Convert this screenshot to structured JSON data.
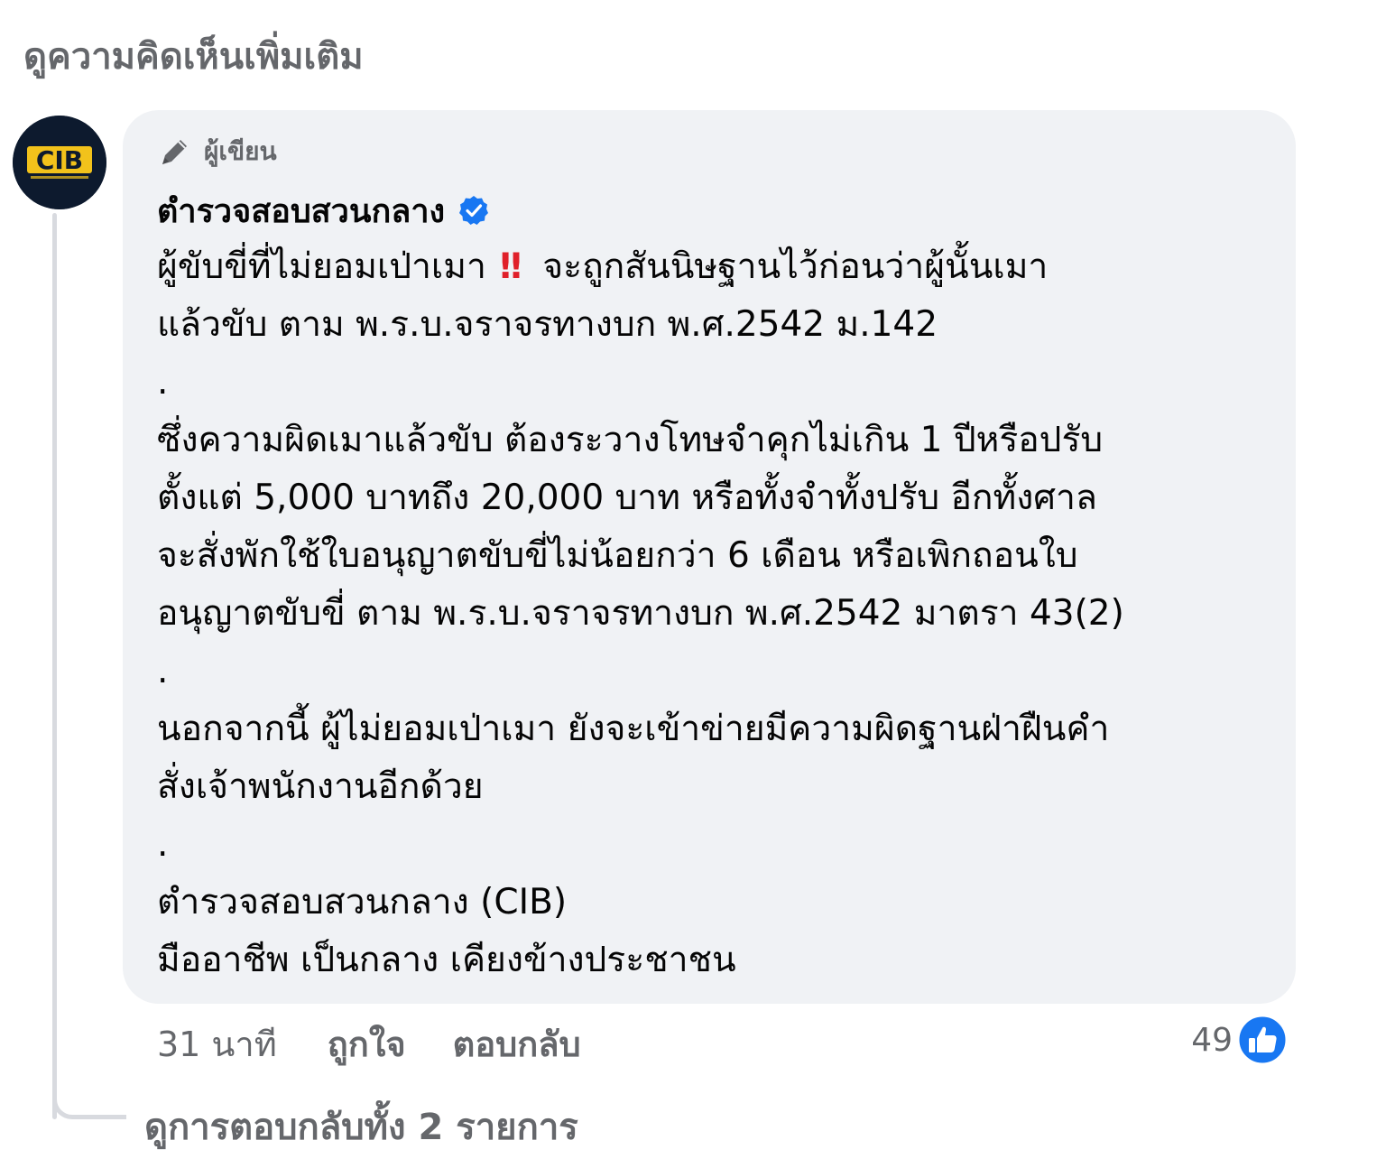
{
  "header": {
    "view_more_comments": "ดูความคิดเห็นเพิ่มเติม"
  },
  "comment": {
    "avatar_text": "CIB",
    "author_badge": "ผู้เขียน",
    "author_name": "ตำรวจสอบสวนกลาง",
    "verified": true,
    "lines": {
      "l1_before": "ผู้ขับขี่ที่ไม่ยอมเป่าเมา",
      "l1_emoji": "!!",
      "l1_after": "จะถูกสันนิษฐานไว้ก่อนว่าผู้นั้นเมา",
      "l2": "แล้วขับ ตาม พ.ร.บ.จราจรทางบก พ.ศ.2542 ม.142",
      "l3": ".",
      "l4": "ซึ่งความผิดเมาแล้วขับ ต้องระวางโทษจำคุกไม่เกิน 1 ปีหรือปรับ",
      "l5": "ตั้งแต่ 5,000 บาทถึง 20,000 บาท หรือทั้งจำทั้งปรับ อีกทั้งศาล",
      "l6": "จะสั่งพักใช้ใบอนุญาตขับขี่ไม่น้อยกว่า 6 เดือน หรือเพิกถอนใบ",
      "l7": "อนุญาตขับขี่ ตาม พ.ร.บ.จราจรทางบก พ.ศ.2542 มาตรา 43(2)",
      "l8": ".",
      "l9": "นอกจากนี้ ผู้ไม่ยอมเป่าเมา ยังจะเข้าข่ายมีความผิดฐานฝ่าฝืนคำ",
      "l10": "สั่งเจ้าพนักงานอีกด้วย",
      "l11": ".",
      "l12": "ตำรวจสอบสวนกลาง (CIB)",
      "l13": "มืออาชีพ เป็นกลาง เคียงข้างประชาชน"
    },
    "time": "31 นาที",
    "like_label": "ถูกใจ",
    "reply_label": "ตอบกลับ",
    "reaction_count": "49",
    "reaction_icon": "like-thumb",
    "colors": {
      "like_blue": "#1877f2",
      "bubble": "#f0f2f5",
      "secondary_text": "#65676b",
      "emoji_red": "#e0202a",
      "avatar_bg": "#0d1a2e",
      "avatar_accent": "#f2c21b"
    }
  },
  "footer": {
    "view_replies": "ดูการตอบกลับทั้ง 2 รายการ"
  }
}
